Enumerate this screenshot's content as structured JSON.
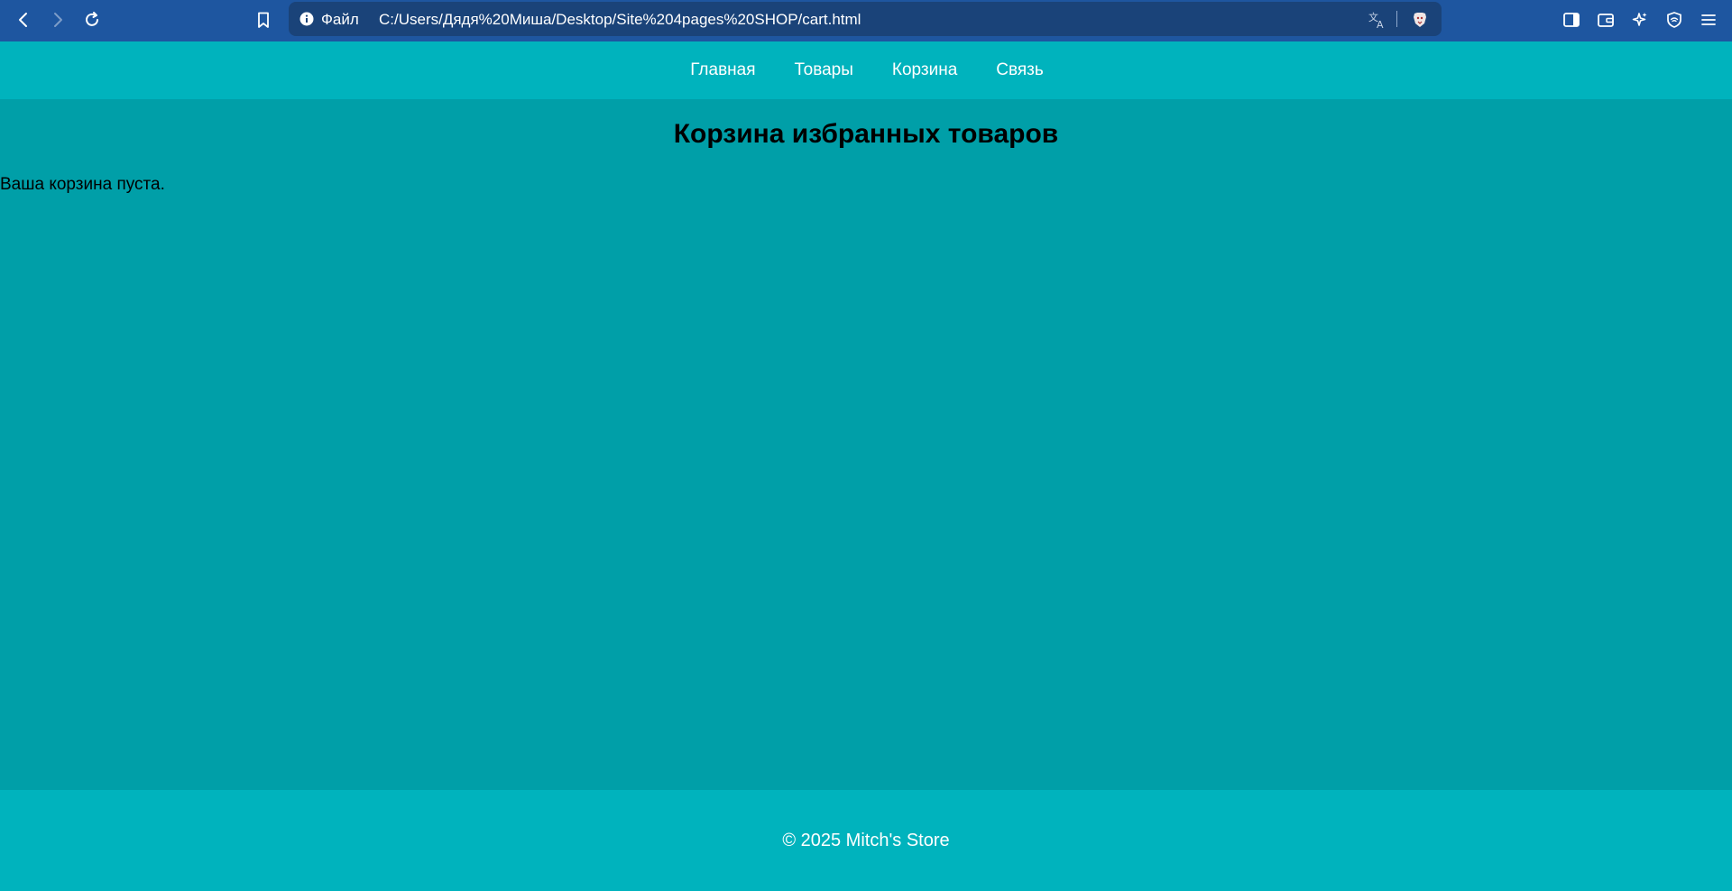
{
  "browser": {
    "back_icon": "chevron-left-icon",
    "forward_icon": "chevron-right-icon",
    "reload_icon": "reload-icon",
    "bookmark_icon": "bookmark-icon",
    "address_bar": {
      "scheme_label": "Файл",
      "url": "C:/Users/Дядя%20Миша/Desktop/Site%204pages%20SHOP/cart.html"
    },
    "toolbar_icons": [
      "sidebar-icon",
      "wallet-icon",
      "leo-ai-icon",
      "vpn-shield-icon",
      "menu-icon"
    ],
    "colors": {
      "bar": "#1e56a0",
      "omnibox": "#1a4379"
    }
  },
  "site": {
    "nav": {
      "items": [
        {
          "label": "Главная"
        },
        {
          "label": "Товары"
        },
        {
          "label": "Корзина"
        },
        {
          "label": "Связь"
        }
      ]
    },
    "main": {
      "heading": "Корзина избранных товаров",
      "empty_message": "Ваша корзина пуста."
    },
    "footer": {
      "text": "© 2025 Mitch's Store"
    },
    "colors": {
      "header": "#00b3bd",
      "background": "#009fa8",
      "footer": "#00b3bd"
    }
  }
}
